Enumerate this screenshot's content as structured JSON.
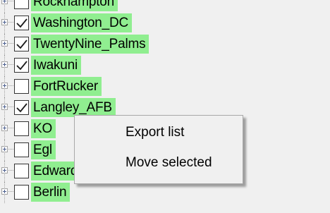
{
  "tree": {
    "items": [
      {
        "label": "Rockhampton",
        "checked": false
      },
      {
        "label": "Washington_DC",
        "checked": true
      },
      {
        "label": "TwentyNine_Palms",
        "checked": true
      },
      {
        "label": "Iwakuni",
        "checked": true
      },
      {
        "label": "FortRucker",
        "checked": false
      },
      {
        "label": "Langley_AFB",
        "checked": true
      },
      {
        "label": "KO",
        "checked": false
      },
      {
        "label": "Egl",
        "checked": false
      },
      {
        "label": "Edwards_AFB",
        "checked": false
      },
      {
        "label": "Berlin",
        "checked": false
      }
    ]
  },
  "context_menu": {
    "items": [
      {
        "label": "Export list"
      },
      {
        "label": "Move selected"
      }
    ]
  },
  "colors": {
    "highlight": "#90ee90",
    "background": "#f0f0f0"
  }
}
